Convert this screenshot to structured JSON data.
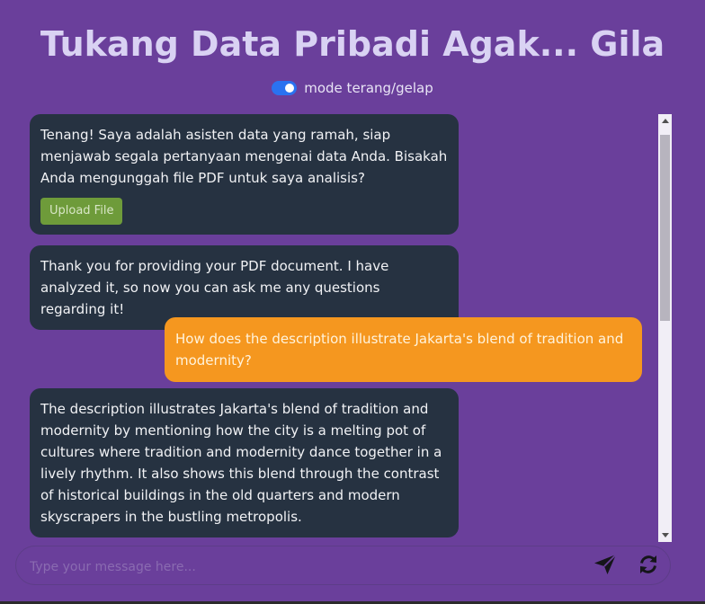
{
  "header": {
    "title": "Tukang Data Pribadi Agak... Gila",
    "mode_label": "mode terang/gelap",
    "dark_mode_enabled": true
  },
  "chat": {
    "messages": [
      {
        "role": "bot",
        "text": "Tenang! Saya adalah asisten data yang ramah, siap menjawab segala pertanyaan mengenai data Anda. Bisakah Anda mengunggah file PDF untuk saya analisis?",
        "button_label": "Upload File"
      },
      {
        "role": "bot",
        "text": "Thank you for providing your PDF document. I have analyzed it, so now you can ask me any questions regarding it!"
      },
      {
        "role": "user",
        "text": "How does the description illustrate Jakarta's blend of tradition and modernity?"
      },
      {
        "role": "bot",
        "text": "The description illustrates Jakarta's blend of tradition and modernity by mentioning how the city is a melting pot of cultures where tradition and modernity dance together in a lively rhythm. It also shows this blend through the contrast of historical buildings in the old quarters and modern skyscrapers in the bustling metropolis."
      }
    ]
  },
  "composer": {
    "placeholder": "Type your message here...",
    "value": ""
  },
  "icons": {
    "send": "paper-plane-icon",
    "refresh": "refresh-icon"
  },
  "colors": {
    "background": "#6a3f9b",
    "bot_bubble": "#263241",
    "user_bubble": "#f5971f",
    "upload_button": "#6e9b3a",
    "toggle": "#2a72f0"
  }
}
